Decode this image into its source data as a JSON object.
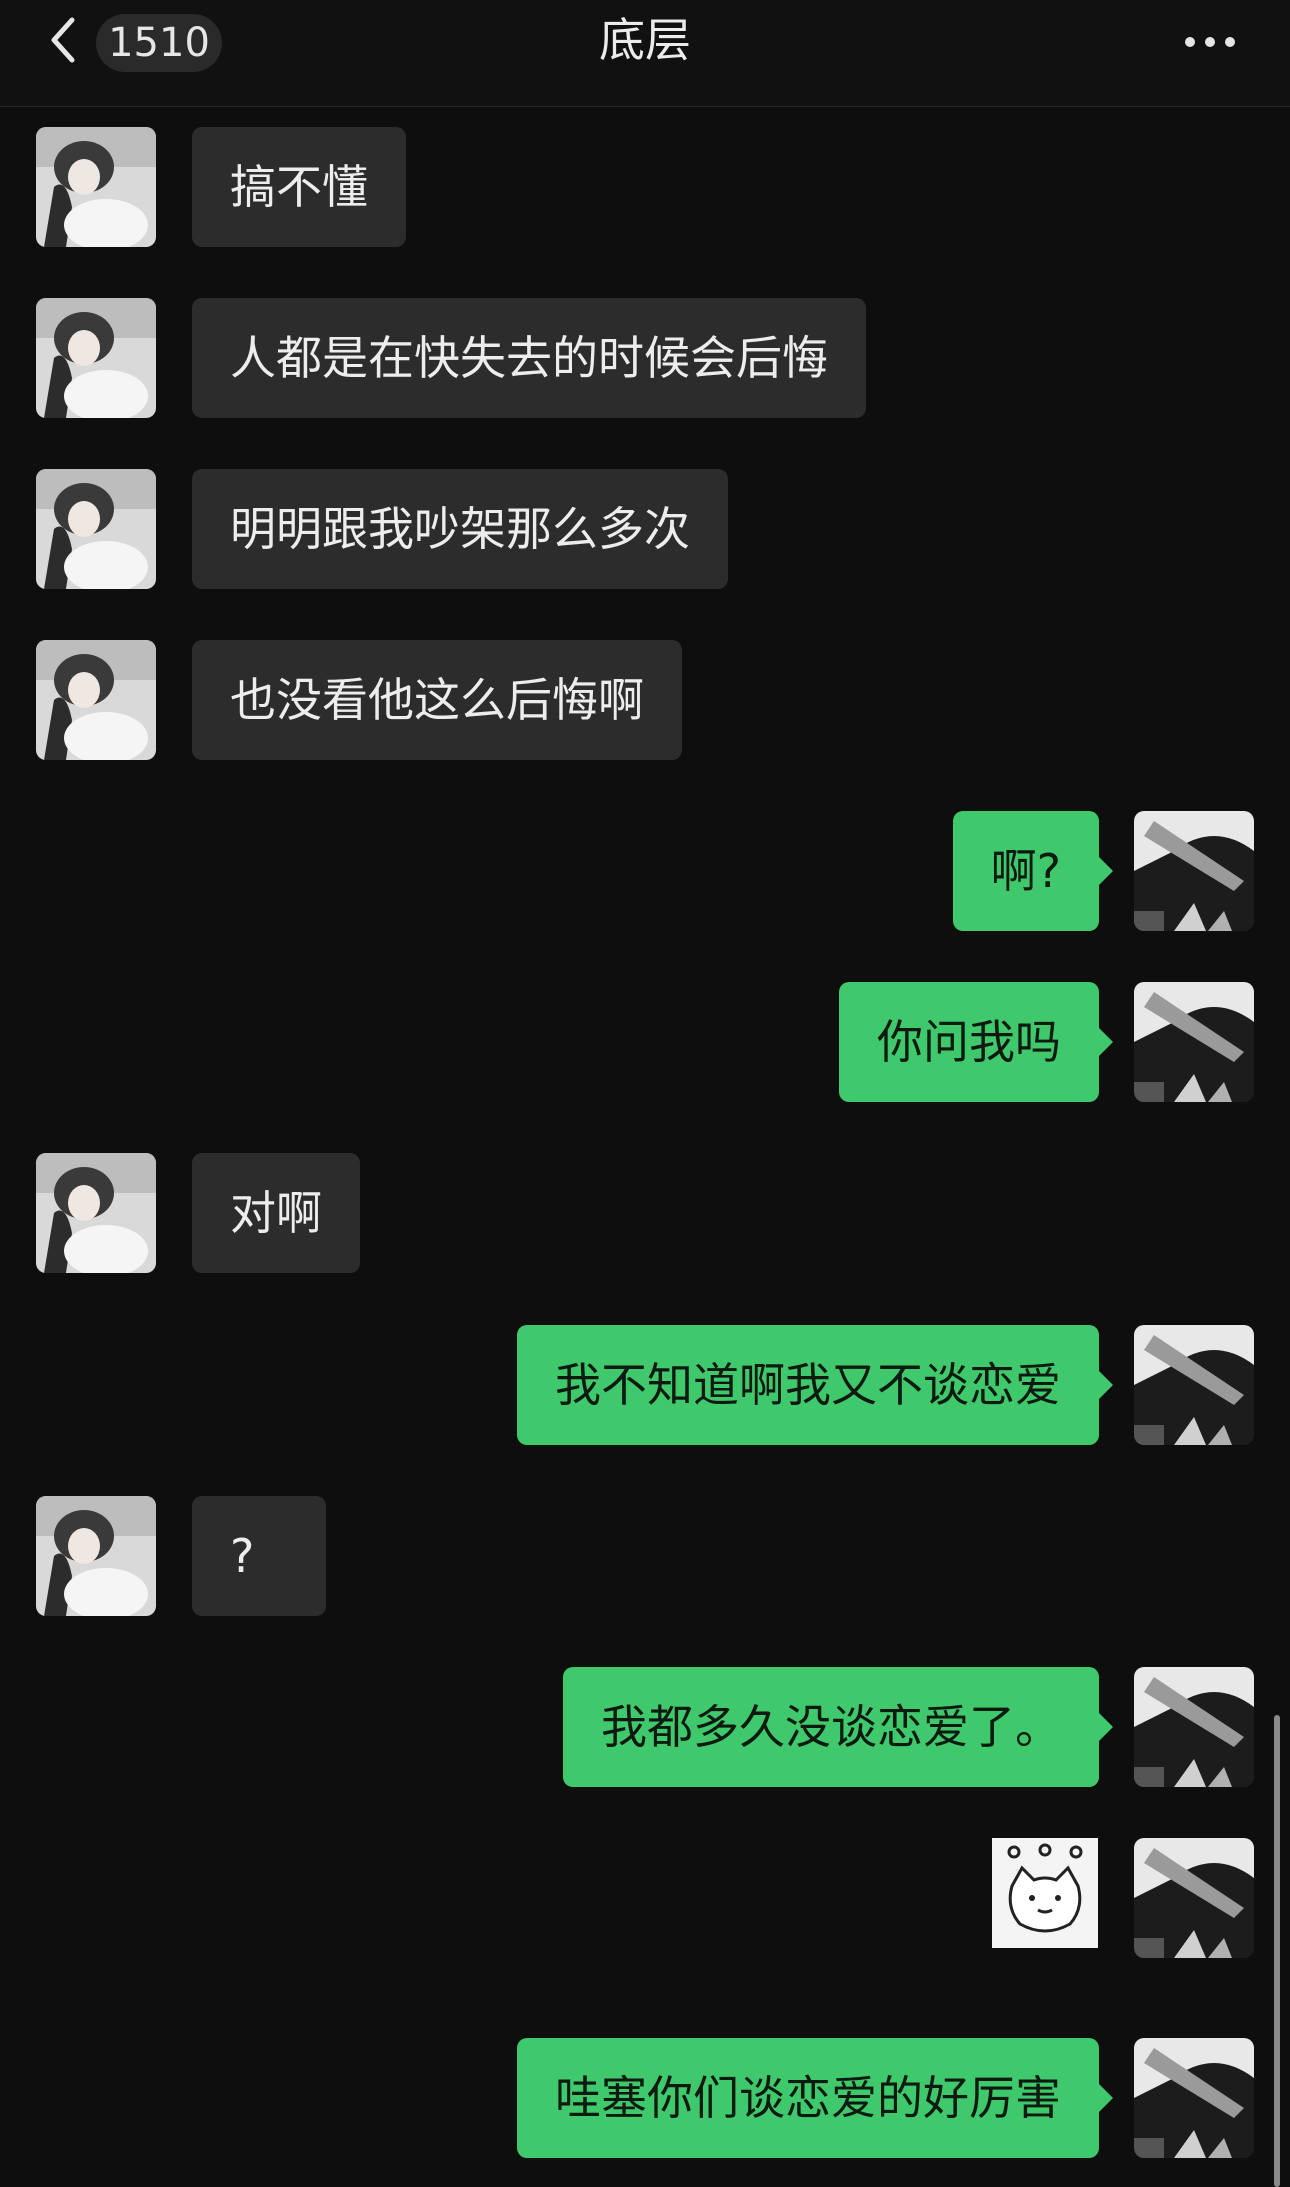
{
  "header": {
    "unread_count": "1510",
    "title": "底层"
  },
  "messages": [
    {
      "side": "in",
      "type": "text",
      "text": "搞不懂"
    },
    {
      "side": "in",
      "type": "text",
      "text": "人都是在快失去的时候会后悔"
    },
    {
      "side": "in",
      "type": "text",
      "text": "明明跟我吵架那么多次"
    },
    {
      "side": "in",
      "type": "text",
      "text": "也没看他这么后悔啊"
    },
    {
      "side": "out",
      "type": "text",
      "text": "啊?"
    },
    {
      "side": "out",
      "type": "text",
      "text": "你问我吗"
    },
    {
      "side": "in",
      "type": "text",
      "text": "对啊"
    },
    {
      "side": "out",
      "type": "text",
      "text": "我不知道啊我又不谈恋爱"
    },
    {
      "side": "in",
      "type": "text",
      "text": "?"
    },
    {
      "side": "out",
      "type": "text",
      "text": "我都多久没谈恋爱了。"
    },
    {
      "side": "out",
      "type": "sticker",
      "sticker": "cat-face-sticker"
    },
    {
      "side": "out",
      "type": "text",
      "text": "哇塞你们谈恋爱的好厉害"
    }
  ],
  "colors": {
    "background": "#0e0e0e",
    "incoming_bubble": "#2c2c2c",
    "outgoing_bubble": "#3fc86c"
  },
  "icons": {
    "back": "chevron-left-icon",
    "more": "more-dots-icon"
  }
}
